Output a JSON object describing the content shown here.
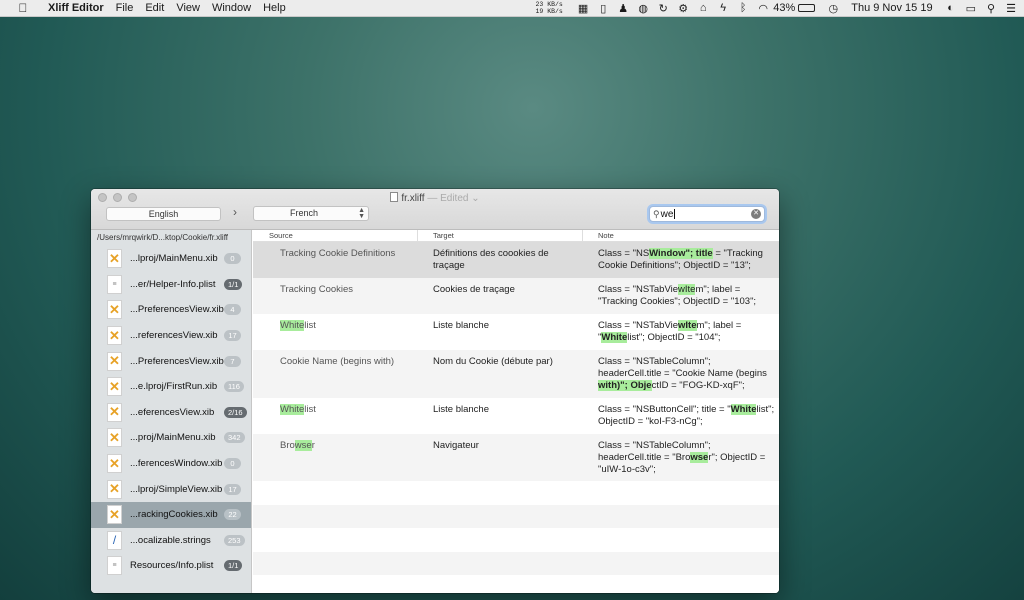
{
  "menubar": {
    "app_name": "Xliff Editor",
    "menus": [
      "File",
      "Edit",
      "View",
      "Window",
      "Help"
    ],
    "net_up": "23 KB/s",
    "net_down": "19 KB/s",
    "battery": "43%",
    "battery_level": 0.43,
    "clock": "Thu 9 Nov  15 19"
  },
  "window": {
    "title": "fr.xliff",
    "title_suffix": "— Edited ⌄",
    "source_language": "English",
    "arrow": "›",
    "target_language": "French",
    "search_value": "we",
    "search_icon_glyph": "⚲"
  },
  "sidebar": {
    "path": "/Users/mrqwirk/D...ktop/Cookie/fr.xliff",
    "files": [
      {
        "name": "...lproj/MainMenu.xib",
        "badge": "0",
        "kind": "xib",
        "badge_style": "light"
      },
      {
        "name": "...er/Helper-Info.plist",
        "badge": "1/1",
        "kind": "plist",
        "badge_style": "dark"
      },
      {
        "name": "...PreferencesView.xib",
        "badge": "4",
        "kind": "xib",
        "badge_style": "light"
      },
      {
        "name": "...referencesView.xib",
        "badge": "17",
        "kind": "xib",
        "badge_style": "light"
      },
      {
        "name": "...PreferencesView.xib",
        "badge": "7",
        "kind": "xib",
        "badge_style": "light"
      },
      {
        "name": "...e.lproj/FirstRun.xib",
        "badge": "116",
        "kind": "xib",
        "badge_style": "light"
      },
      {
        "name": "...eferencesView.xib",
        "badge": "2/16",
        "kind": "xib",
        "badge_style": "dark"
      },
      {
        "name": "...proj/MainMenu.xib",
        "badge": "342",
        "kind": "xib",
        "badge_style": "light"
      },
      {
        "name": "...ferencesWindow.xib",
        "badge": "0",
        "kind": "xib",
        "badge_style": "light"
      },
      {
        "name": "...lproj/SimpleView.xib",
        "badge": "17",
        "kind": "xib",
        "badge_style": "light"
      },
      {
        "name": "...rackingCookies.xib",
        "badge": "22",
        "kind": "xib",
        "badge_style": "sel",
        "selected": true
      },
      {
        "name": "...ocalizable.strings",
        "badge": "253",
        "kind": "strings",
        "badge_style": "light"
      },
      {
        "name": "Resources/Info.plist",
        "badge": "1/1",
        "kind": "plist",
        "badge_style": "dark"
      }
    ]
  },
  "table": {
    "columns": [
      "Source",
      "Target",
      "Note"
    ],
    "rows": [
      {
        "source": [
          [
            "Tracking Cookie Definitions",
            ""
          ]
        ],
        "target": "Définitions des coookies de traçage",
        "note": [
          [
            "Class = \"NS",
            ""
          ],
          [
            "Window\"; title",
            "bold"
          ],
          [
            " = \"Tracking Cookie Definitions\"; ObjectID = \"13\";",
            ""
          ]
        ],
        "selected": true
      },
      {
        "source": [
          [
            "Tracking Cookies",
            ""
          ]
        ],
        "target": "Cookies de traçage",
        "note": [
          [
            "Class = \"NSTabVie",
            ""
          ],
          [
            "wIte",
            "plain"
          ],
          [
            "m\"; label = \"Tracking Cookies\"; ObjectID = \"103\";",
            ""
          ]
        ]
      },
      {
        "source": [
          [
            "White",
            "plain"
          ],
          [
            "list",
            ""
          ]
        ],
        "target": "Liste blanche",
        "note": [
          [
            "Class = \"NSTabVie",
            ""
          ],
          [
            "wIte",
            "bold"
          ],
          [
            "m\"; label = \"",
            ""
          ],
          [
            "White",
            "bold"
          ],
          [
            "list\"; ObjectID = \"104\";",
            ""
          ]
        ]
      },
      {
        "source": [
          [
            "Cookie Name (begins with)",
            ""
          ]
        ],
        "target": "Nom du Cookie (débute par)",
        "note": [
          [
            "Class = \"NSTableColumn\"; headerCell.title = \"Cookie Name (begins ",
            ""
          ],
          [
            "with)\"; Obje",
            "bold"
          ],
          [
            "ctID = \"FOG-KD-xqF\";",
            ""
          ]
        ]
      },
      {
        "source": [
          [
            "White",
            "plain"
          ],
          [
            "list",
            ""
          ]
        ],
        "target": "Liste blanche",
        "note": [
          [
            "Class = \"NSButtonCell\"; title = \"",
            ""
          ],
          [
            "White",
            "bold"
          ],
          [
            "list\"; ObjectID = \"koI-F3-nCg\";",
            ""
          ]
        ]
      },
      {
        "source": [
          [
            "Bro",
            ""
          ],
          [
            "wse",
            "plain"
          ],
          [
            "r",
            ""
          ]
        ],
        "target": "Navigateur",
        "note": [
          [
            "Class = \"NSTableColumn\"; headerCell.title = \"Bro",
            ""
          ],
          [
            "wse",
            "bold"
          ],
          [
            "r\"; ObjectID = \"uIW-1o-c3v\";",
            ""
          ]
        ]
      }
    ]
  },
  "colors": {
    "highlight": "#a8ec9c",
    "sidebar_bg": "#dde1e3",
    "sidebar_selected": "#9aa6ac",
    "row_selected": "#dcdcdc"
  }
}
